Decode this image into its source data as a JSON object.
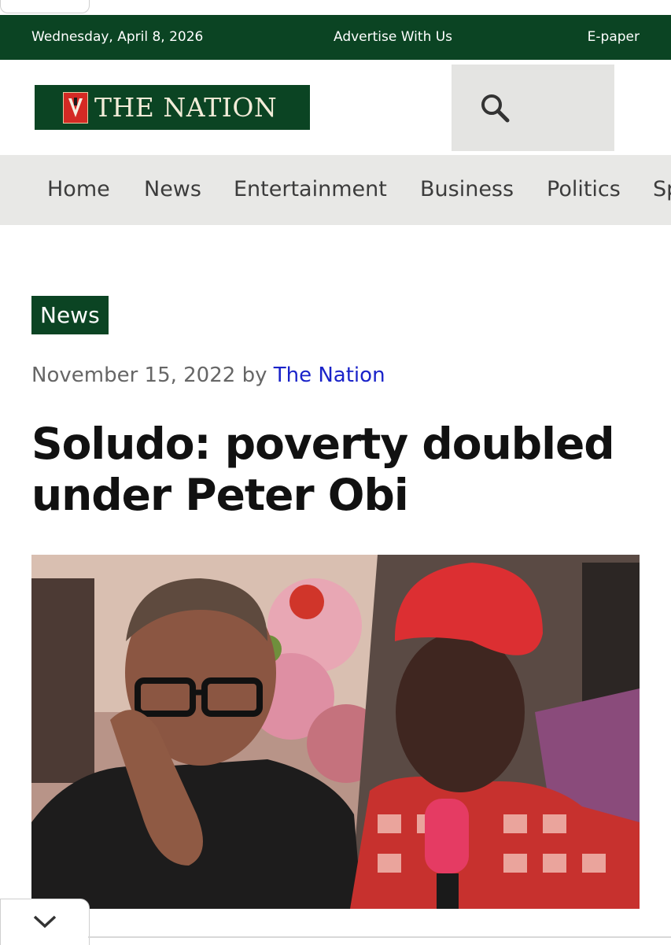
{
  "topbar": {
    "date": "Wednesday, April 8, 2026",
    "advertise": "Advertise With Us",
    "epaper": "E-paper"
  },
  "logo": {
    "text": "THE NATION"
  },
  "search": {
    "icon": "search-icon"
  },
  "nav": {
    "items": [
      {
        "label": "Home"
      },
      {
        "label": "News"
      },
      {
        "label": "Entertainment"
      },
      {
        "label": "Business"
      },
      {
        "label": "Politics"
      },
      {
        "label": "Sp"
      }
    ]
  },
  "article": {
    "category": "News",
    "date": "November 15, 2022",
    "by": "by",
    "author": "The Nation",
    "headline_line1": "Soludo: poverty doubled",
    "headline_line2": "under Peter Obi"
  },
  "bottom": {
    "icon": "chevron-down-icon"
  },
  "colors": {
    "brand_green": "#0b4423",
    "nav_bg": "#e8e8e6",
    "author_link": "#1a23c9"
  }
}
